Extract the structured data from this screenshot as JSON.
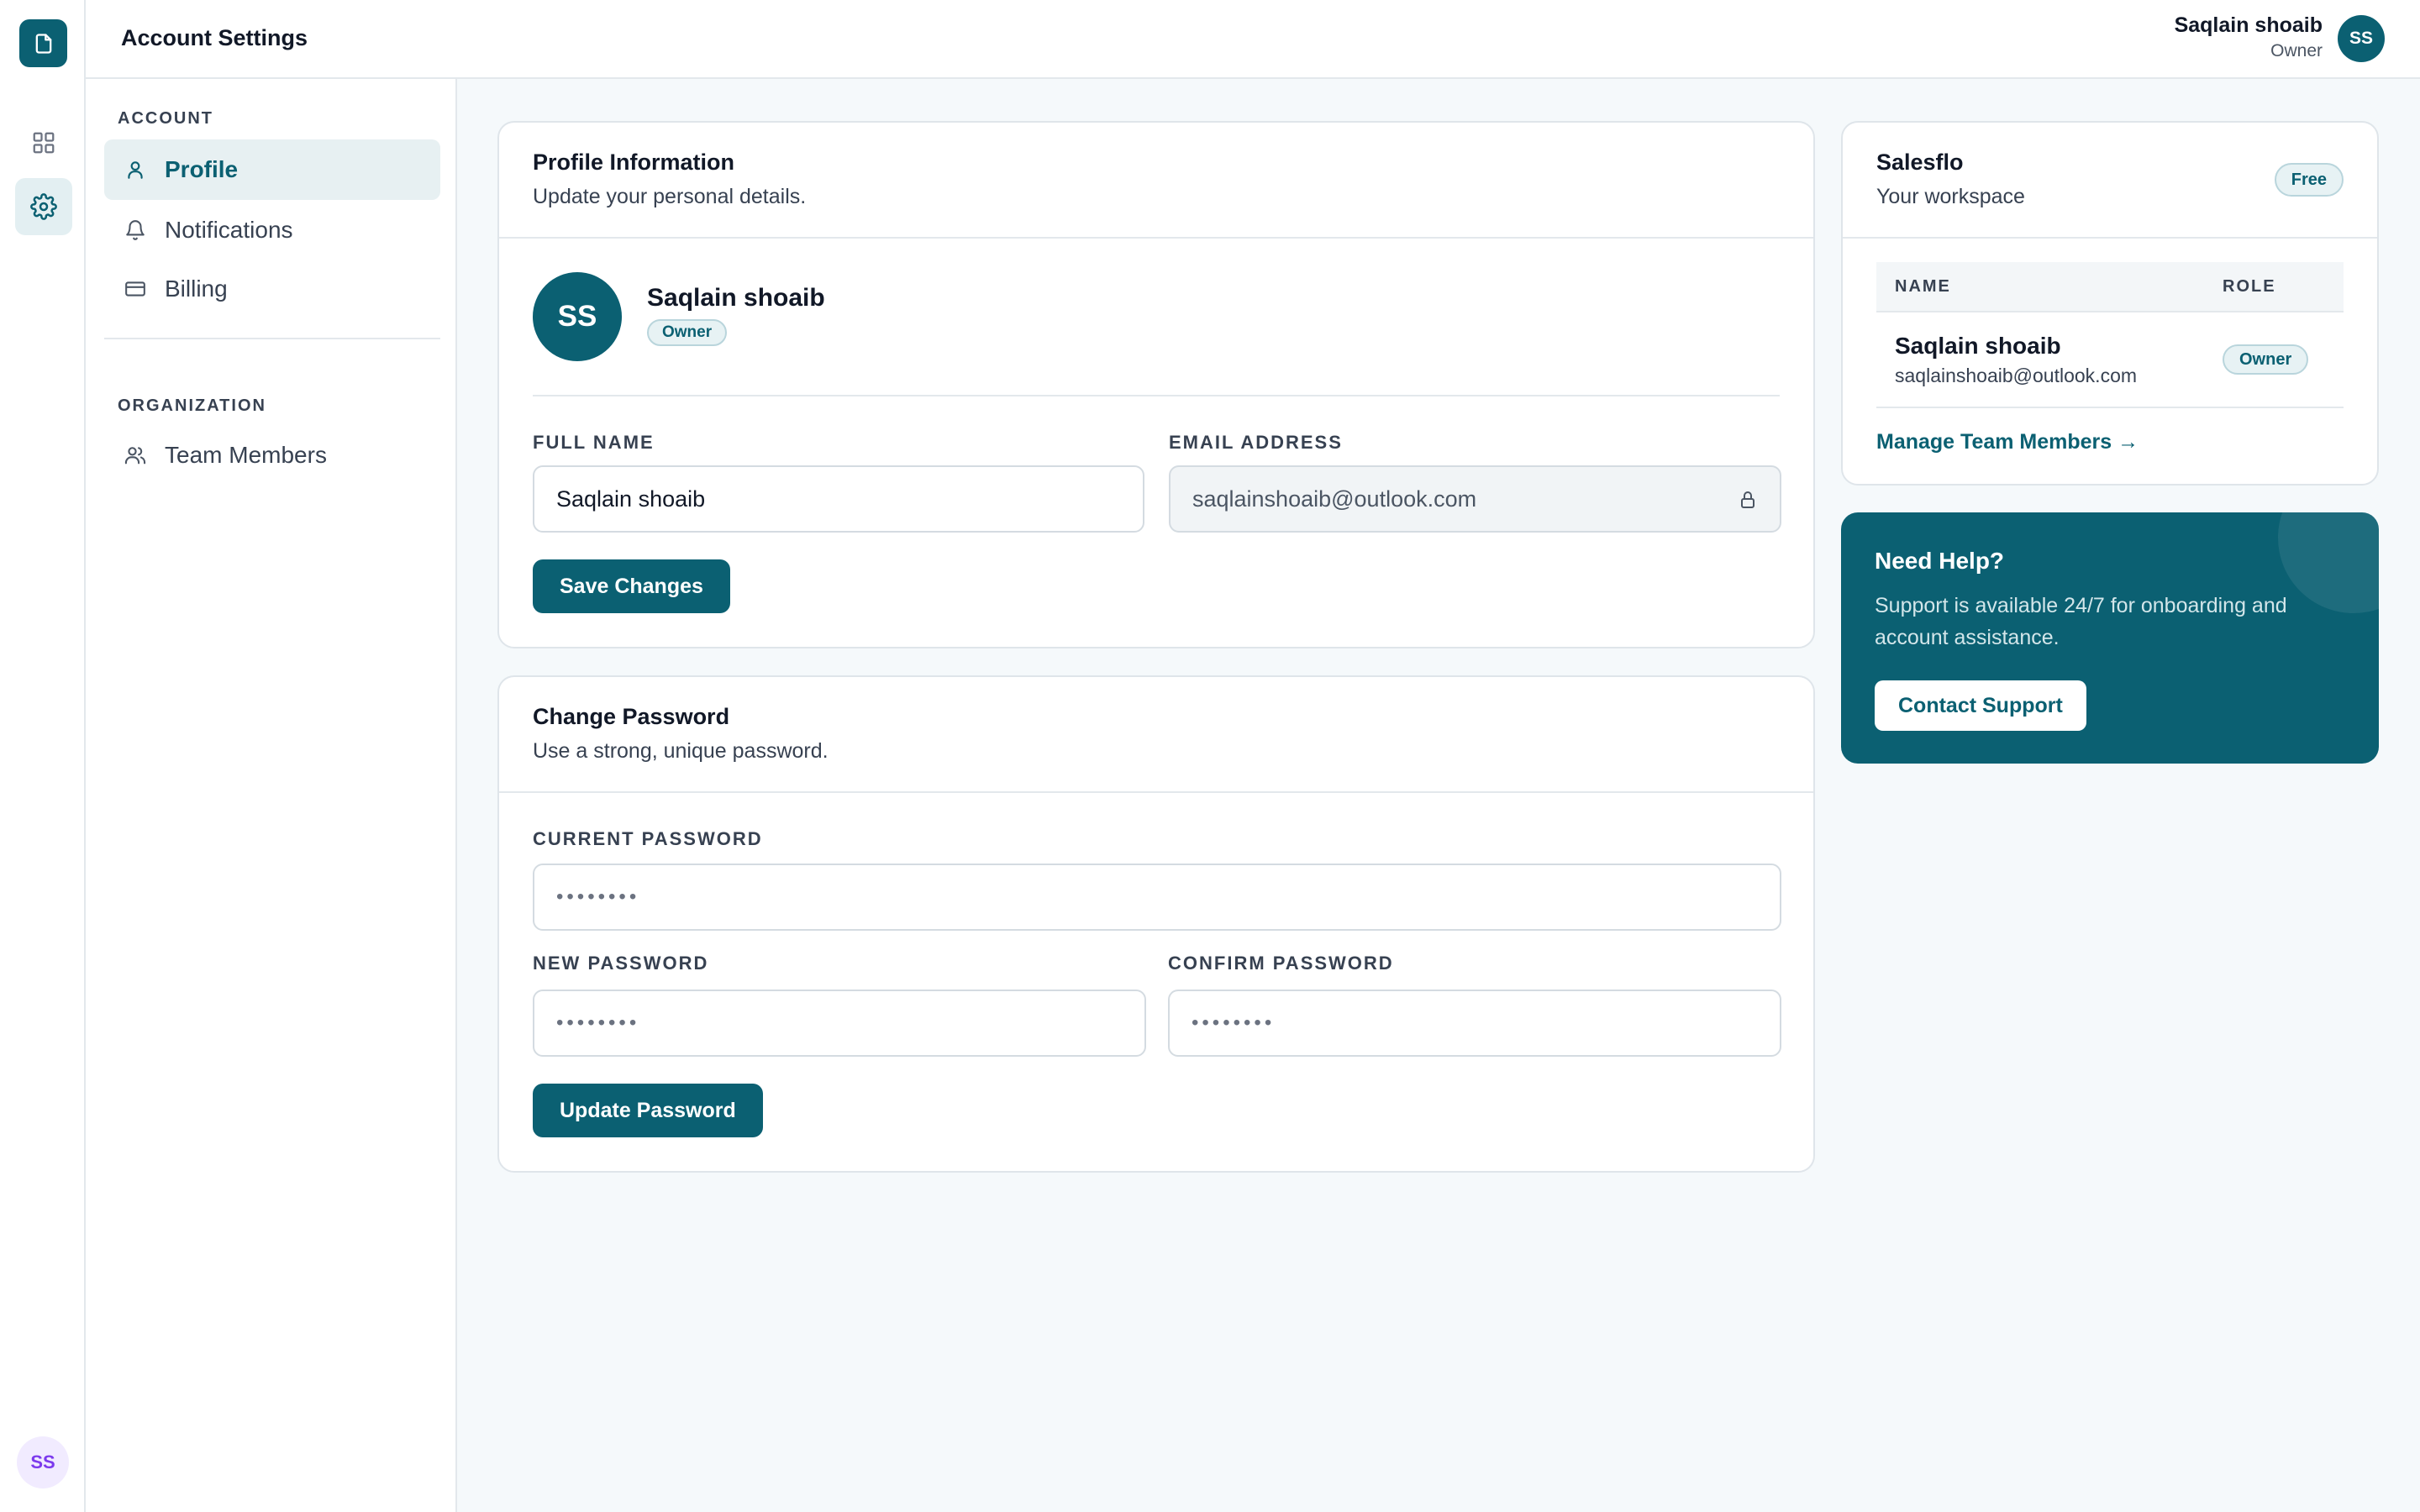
{
  "app": {
    "logo_icon": "document-icon"
  },
  "rail": {
    "items": [
      {
        "icon": "grid-icon",
        "active": false
      },
      {
        "icon": "gear-icon",
        "active": true
      }
    ],
    "avatar_initials": "SS"
  },
  "header": {
    "title": "Account Settings",
    "user_name": "Saqlain shoaib",
    "user_role": "Owner",
    "avatar_initials": "SS"
  },
  "sidebar": {
    "account_section": "ACCOUNT",
    "account_items": [
      {
        "label": "Profile",
        "icon": "user-icon",
        "active": true
      },
      {
        "label": "Notifications",
        "icon": "bell-icon",
        "active": false
      },
      {
        "label": "Billing",
        "icon": "credit-card-icon",
        "active": false
      }
    ],
    "org_section": "ORGANIZATION",
    "org_items": [
      {
        "label": "Team Members",
        "icon": "users-icon",
        "active": false
      }
    ]
  },
  "profile_card": {
    "title": "Profile Information",
    "subtitle": "Update your personal details.",
    "avatar_initials": "SS",
    "name": "Saqlain shoaib",
    "role_badge": "Owner",
    "full_name_label": "FULL NAME",
    "full_name_value": "Saqlain shoaib",
    "email_label": "EMAIL ADDRESS",
    "email_value": "saqlainshoaib@outlook.com",
    "save_button": "Save Changes"
  },
  "password_card": {
    "title": "Change Password",
    "subtitle": "Use a strong, unique password.",
    "current_label": "CURRENT PASSWORD",
    "current_value": "••••••••",
    "new_label": "NEW PASSWORD",
    "new_value": "••••••••",
    "confirm_label": "CONFIRM PASSWORD",
    "confirm_value": "••••••••",
    "update_button": "Update Password"
  },
  "workspace_card": {
    "name": "Salesflo",
    "subtitle": "Your workspace",
    "plan_badge": "Free",
    "columns": [
      "NAME",
      "ROLE"
    ],
    "members": [
      {
        "name": "Saqlain shoaib",
        "email": "saqlainshoaib@outlook.com",
        "role": "Owner"
      }
    ],
    "manage_link": "Manage Team Members →"
  },
  "help_card": {
    "title": "Need Help?",
    "text": "Support is available 24/7 for onboarding and account assistance.",
    "button": "Contact Support"
  },
  "colors": {
    "primary": "#0b6072",
    "background": "#f5f9fb",
    "badge_bg": "#e7f2f4"
  }
}
